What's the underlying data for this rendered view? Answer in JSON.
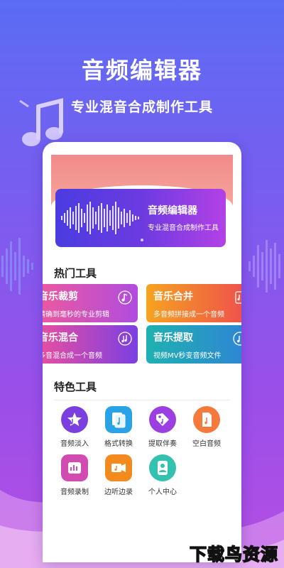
{
  "promo": {
    "headline": "音频编辑器",
    "subline": "专业混音合成制作工具"
  },
  "banner": {
    "title": "音频编辑器",
    "subtitle": "专业混音合成制作工具"
  },
  "hot_tools": {
    "title": "热门工具",
    "items": [
      {
        "title": "音乐裁剪",
        "desc": "精确到毫秒的专业剪辑"
      },
      {
        "title": "音乐合并",
        "desc": "多音频拼接成一个音频"
      },
      {
        "title": "音乐混合",
        "desc": "多音混合成一个音频"
      },
      {
        "title": "音乐提取",
        "desc": "视频MV秒变音频文件"
      }
    ]
  },
  "featured_tools": {
    "title": "特色工具",
    "items": [
      {
        "label": "音频淡入",
        "icon": "star-icon"
      },
      {
        "label": "格式转换",
        "icon": "convert-icon"
      },
      {
        "label": "提取伴奏",
        "icon": "tag-icon"
      },
      {
        "label": "空白音频",
        "icon": "blank-file-icon"
      },
      {
        "label": "音频录制",
        "icon": "record-icon"
      },
      {
        "label": "边听边录",
        "icon": "video-camera-icon"
      },
      {
        "label": "个人中心",
        "icon": "user-icon"
      }
    ]
  },
  "watermark": "下载鸟资源",
  "colors": {
    "background_top": "#5b6cf3",
    "background_bottom": "#b54fe2",
    "card_pink": "#e452a0",
    "card_orange": "#f26a3a",
    "card_purple": "#8e3fe0",
    "card_teal": "#1fa6b6"
  }
}
